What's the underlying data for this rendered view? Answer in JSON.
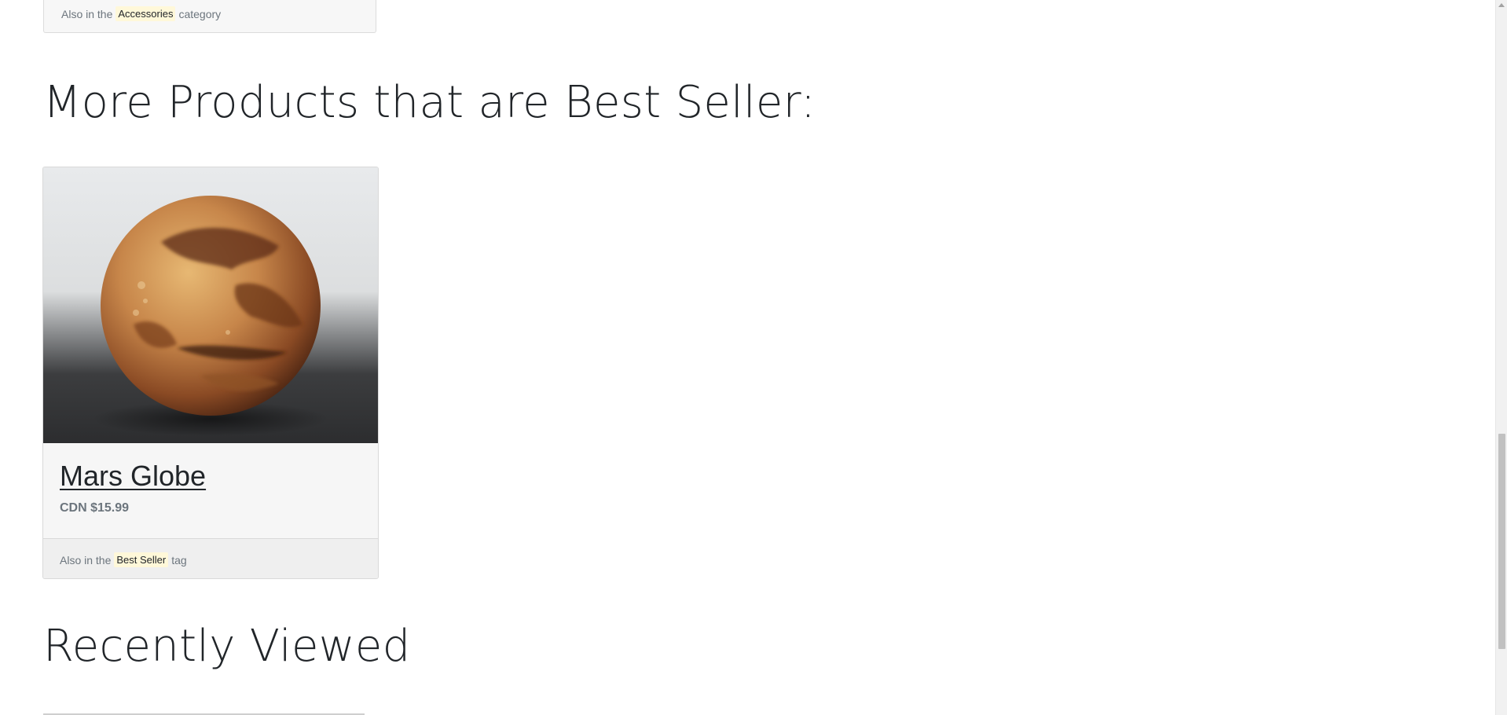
{
  "top_card": {
    "footer_prefix": "Also in the",
    "footer_chip": "Accessories",
    "footer_suffix": "category"
  },
  "best_seller_section": {
    "title": "More Products that are Best Seller:",
    "products": [
      {
        "image_alt": "Mars Globe",
        "name": "Mars Globe",
        "price": "CDN $15.99",
        "footer_prefix": "Also in the",
        "footer_chip": "Best Seller",
        "footer_suffix": "tag"
      }
    ]
  },
  "recently_viewed_section": {
    "title": "Recently Viewed"
  },
  "colors": {
    "chip_background": "#fff8d9",
    "card_background": "#f6f6f6",
    "muted_text": "#6c757d"
  }
}
